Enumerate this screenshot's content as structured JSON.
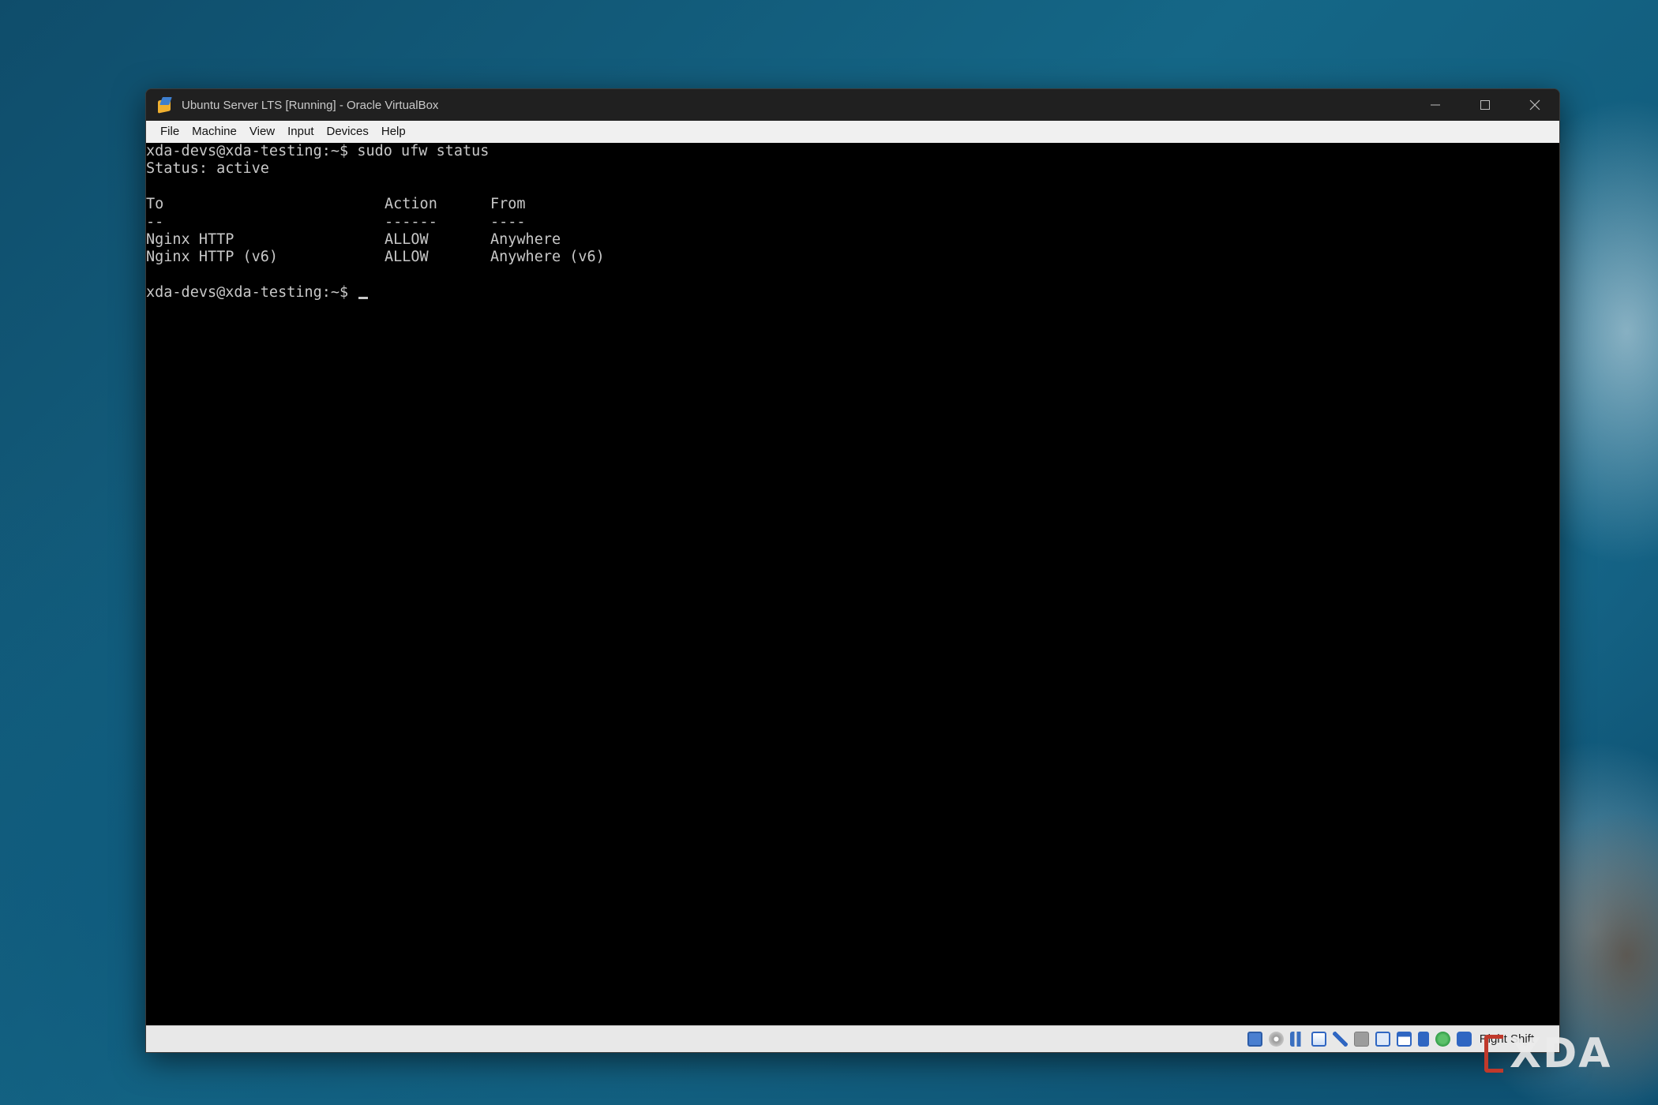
{
  "window": {
    "title": "Ubuntu Server LTS [Running] - Oracle VirtualBox",
    "app_icon": "virtualbox-icon",
    "controls": [
      "minimize-icon",
      "maximize-icon",
      "close-icon"
    ]
  },
  "menubar": {
    "items": [
      "File",
      "Machine",
      "View",
      "Input",
      "Devices",
      "Help"
    ]
  },
  "terminal": {
    "prompt": "xda-devs@xda-testing:~$",
    "command": "sudo ufw status",
    "status_line": "Status: active",
    "table": {
      "headers": [
        "To",
        "Action",
        "From"
      ],
      "separators": [
        "--",
        "------",
        "----"
      ],
      "rows": [
        [
          "Nginx HTTP",
          "ALLOW",
          "Anywhere"
        ],
        [
          "Nginx HTTP (v6)",
          "ALLOW",
          "Anywhere (v6)"
        ]
      ]
    },
    "final_prompt": "xda-devs@xda-testing:~$"
  },
  "statusbar": {
    "icons": [
      "hard-disk-icon",
      "optical-disk-icon",
      "audio-icon",
      "network-icon",
      "usb-icon",
      "shared-folders-icon",
      "display-icon",
      "recording-icon",
      "vt-x-icon",
      "mouse-integration-icon",
      "keyboard-capture-icon"
    ],
    "host_key": "Right Shift"
  },
  "watermark": {
    "text": "XDA"
  },
  "colors": {
    "terminal_bg": "#000000",
    "terminal_fg": "#c8c8c8",
    "titlebar_bg": "#202020",
    "menubar_bg": "#f0f0f0"
  }
}
